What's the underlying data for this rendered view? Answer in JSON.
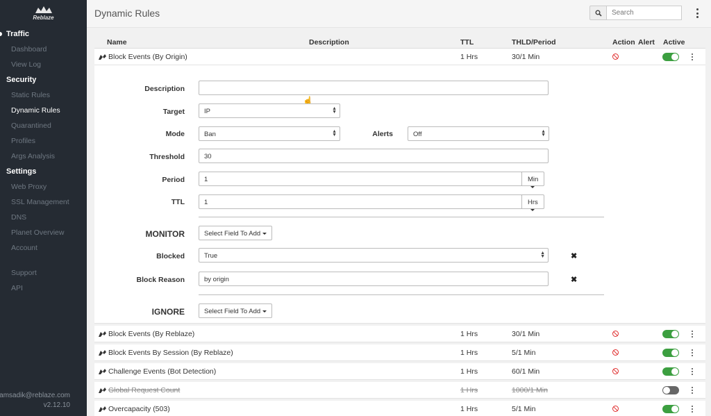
{
  "app": {
    "logo_text": "Reblaze",
    "user_email": "amsadik@reblaze.com",
    "version": "v2.12.10"
  },
  "sidebar": {
    "sections": [
      {
        "label": "Traffic",
        "items": [
          "Dashboard",
          "View Log"
        ]
      },
      {
        "label": "Security",
        "items": [
          "Static Rules",
          "Dynamic Rules",
          "Quarantined",
          "Profiles",
          "Args Analysis"
        ]
      },
      {
        "label": "Settings",
        "items": [
          "Web Proxy",
          "SSL Management",
          "DNS",
          "Planet Overview",
          "Account"
        ]
      }
    ],
    "extra": [
      "Support",
      "API"
    ],
    "active_item": "Dynamic Rules"
  },
  "header": {
    "title": "Dynamic Rules",
    "search_placeholder": "Search"
  },
  "table": {
    "columns": {
      "name": "Name",
      "description": "Description",
      "ttl": "TTL",
      "thld": "THLD/Period",
      "action": "Action",
      "alert": "Alert",
      "active": "Active"
    },
    "rows": [
      {
        "name": "Block Events (By Origin)",
        "ttl": "1 Hrs",
        "thld": "30/1 Min",
        "action": "ban",
        "active": true,
        "disabled": false
      },
      {
        "name": "Block Events (By Reblaze)",
        "ttl": "1 Hrs",
        "thld": "30/1 Min",
        "action": "ban",
        "active": true,
        "disabled": false
      },
      {
        "name": "Block Events By Session (By Reblaze)",
        "ttl": "1 Hrs",
        "thld": "5/1 Min",
        "action": "ban",
        "active": true,
        "disabled": false
      },
      {
        "name": "Challenge Events (Bot Detection)",
        "ttl": "1 Hrs",
        "thld": "60/1 Min",
        "action": "ban",
        "active": true,
        "disabled": false
      },
      {
        "name": "Global Request Count",
        "ttl": "1 Hrs",
        "thld": "1000/1 Min",
        "action": "",
        "active": false,
        "disabled": true
      },
      {
        "name": "Overcapacity (503)",
        "ttl": "1 Hrs",
        "thld": "5/1 Min",
        "action": "ban",
        "active": true,
        "disabled": false
      }
    ]
  },
  "form": {
    "labels": {
      "description": "Description",
      "target": "Target",
      "mode": "Mode",
      "alerts": "Alerts",
      "threshold": "Threshold",
      "period": "Period",
      "ttl": "TTL",
      "monitor": "MONITOR",
      "blocked": "Blocked",
      "block_reason": "Block Reason",
      "ignore": "IGNORE"
    },
    "values": {
      "description": "",
      "target": "IP",
      "mode": "Ban",
      "alerts": "Off",
      "threshold": "30",
      "period": "1",
      "period_unit": "Min",
      "ttl": "1",
      "ttl_unit": "Hrs",
      "blocked": "True",
      "block_reason": "by origin"
    },
    "add_field_label": "Select Field To Add"
  },
  "icons": [
    "reblaze-logo",
    "search-icon",
    "kebab-icon",
    "flag-icon",
    "ban-icon",
    "toggle-icon",
    "remove-x-icon",
    "hand-cursor-icon"
  ],
  "colors": {
    "sidebar_bg": "#252b33",
    "toggle_on": "#3c9f40",
    "ban": "#e03030"
  }
}
